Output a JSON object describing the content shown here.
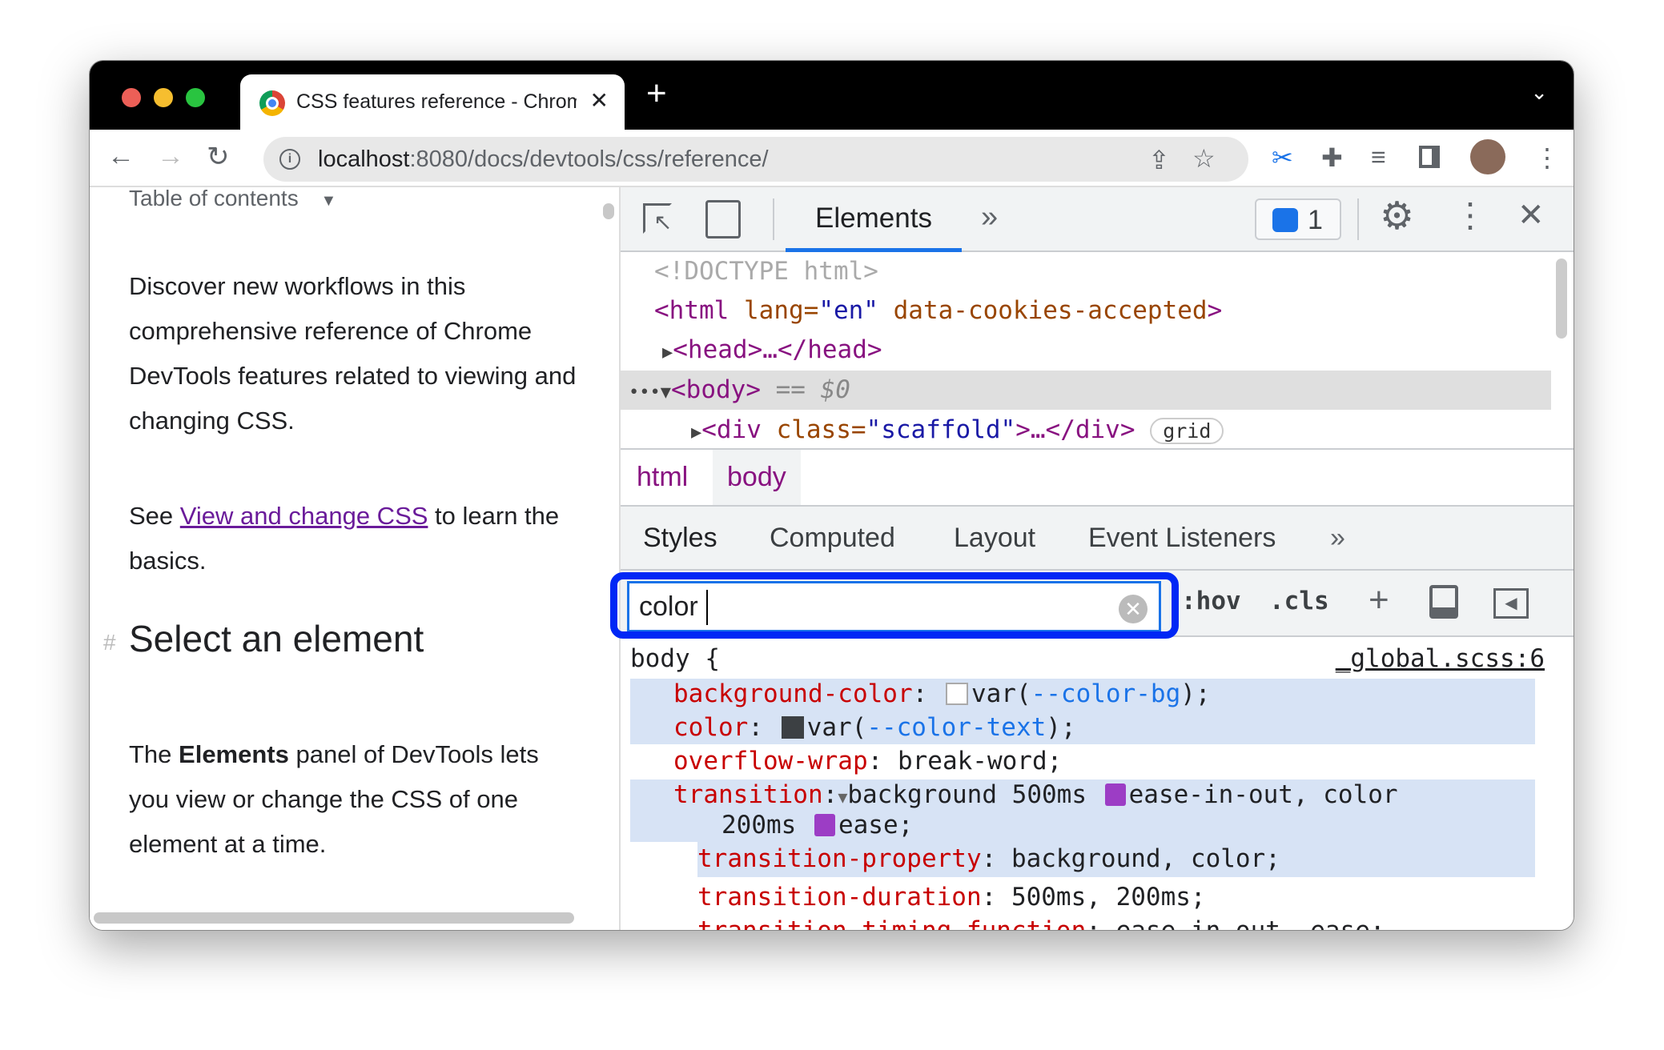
{
  "browser": {
    "tab_title": "CSS features reference - Chrome DevTools",
    "url_host": "localhost",
    "url_path": ":8080/docs/devtools/css/reference/"
  },
  "page": {
    "toc": "Table of contents",
    "intro": "Discover new workflows in this comprehensive reference of Chrome DevTools features related to viewing and changing CSS.",
    "see_pre": "See ",
    "see_link": "View and change CSS",
    "see_post": " to learn the basics.",
    "heading_hash": "#",
    "heading": "Select an element",
    "p2_pre": "The ",
    "p2_bold": "Elements",
    "p2_post": " panel of DevTools lets you view or change the CSS of one element at a time."
  },
  "devtools": {
    "tab": "Elements",
    "more": "»",
    "issues_count": "1",
    "dom": {
      "doctype": "<!DOCTYPE html>",
      "html_open": "<html",
      "lang_attr": " lang=",
      "lang_val": "\"en\"",
      "cookies_attr": " data-cookies-accepted",
      "gt": ">",
      "head": "<head>…</head>",
      "body": "<body>",
      "body_sel": " == $0",
      "div_open": "<div",
      "div_attr": " class=",
      "div_val": "\"scaffold\"",
      "div_close": ">…</div>",
      "grid_badge": "grid"
    },
    "breadcrumbs": [
      "html",
      "body"
    ],
    "style_tabs": [
      "Styles",
      "Computed",
      "Layout",
      "Event Listeners",
      "»"
    ],
    "filter": {
      "value": "color"
    },
    "hov": ":hov",
    "cls": ".cls",
    "rule": {
      "selector": "body {",
      "source": "_global.scss:6",
      "bg_prop": "background-color",
      "bg_val_pre": "var(",
      "bg_var": "--color-bg",
      "bg_val_post": ");",
      "color_prop": "color",
      "color_val_pre": "var(",
      "color_var": "--color-text",
      "color_val_post": ");",
      "ow_prop": "overflow-wrap",
      "ow_val": "break-word;",
      "tr_prop": "transition",
      "tr_val1": "background 500ms ",
      "tr_val2": "ease-in-out, color",
      "tr_val3": "200ms ",
      "tr_val4": "ease;",
      "tp_prop": "transition-property",
      "tp_val": "background, color;",
      "td_prop": "transition-duration",
      "td_val": "500ms, 200ms;",
      "ttf_prop": "transition-timing-function",
      "ttf_val": "ease-in-out, ease;"
    }
  }
}
